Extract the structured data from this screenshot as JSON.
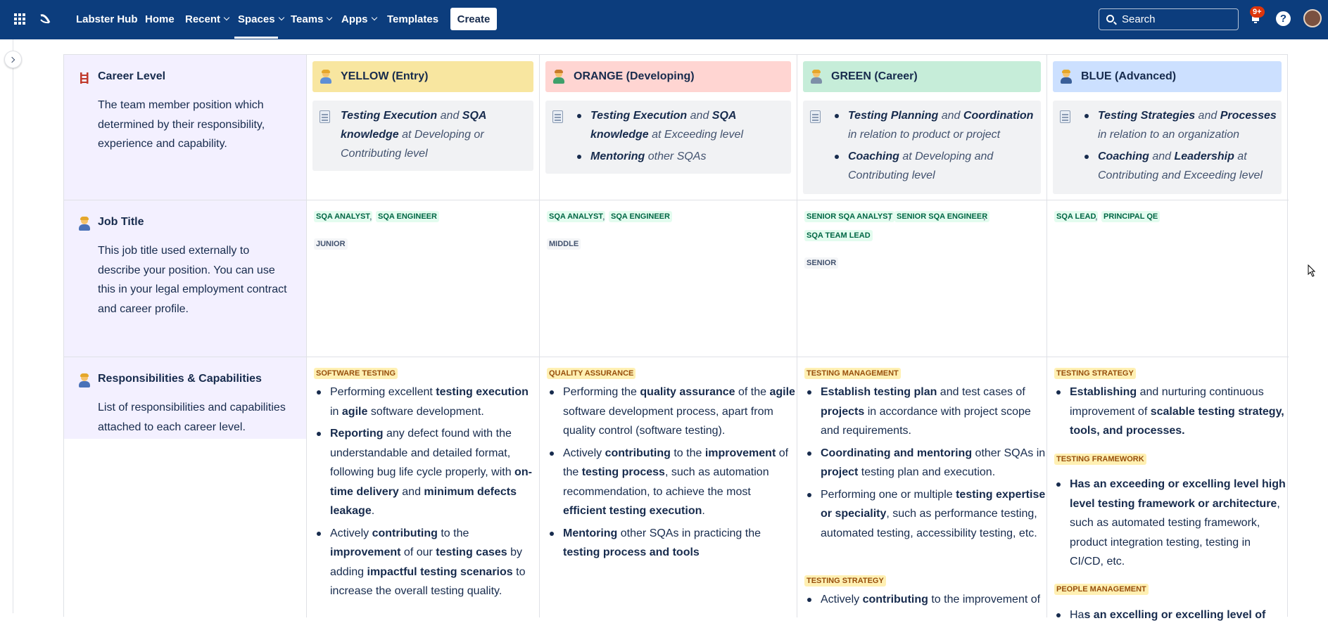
{
  "nav": {
    "brand": "Labster Hub",
    "home": "Home",
    "recent": "Recent",
    "spaces": "Spaces",
    "teams": "Teams",
    "apps": "Apps",
    "templates": "Templates",
    "create": "Create",
    "search_placeholder": "Search",
    "notif_badge": "9+",
    "help": "?"
  },
  "colors": {
    "topbar": "#0c3d7d",
    "yellow": "#f8e6a0",
    "orange": "#ffd5d2",
    "green": "#c6edd9",
    "blue": "#cce0ff",
    "rowhead": "#f3f0ff"
  },
  "levels": [
    {
      "label": "YELLOW (Entry)"
    },
    {
      "label": "ORANGE (Developing)"
    },
    {
      "label": "GREEN (Career)"
    },
    {
      "label": "BLUE (Advanced)"
    }
  ],
  "rows": {
    "career": {
      "title": "Career Level",
      "desc": "The team member position which determined by their responsibility, experience and capability.",
      "icon": "ladder-icon"
    },
    "job": {
      "title": "Job Title",
      "desc": "This job title used externally to describe your position. You can use this in your legal employment contract and career profile.",
      "icon": "person-icon"
    },
    "resp": {
      "title": "Responsibilities & Capabilities",
      "desc": "List of responsibilities and capabilities attached to each career level.",
      "icon": "person-icon"
    }
  },
  "career_cells": {
    "yellow": {
      "p1": "Testing Execution",
      "p2": " and ",
      "p3": "SQA knowledge",
      "p4": " at Developing or Contributing level"
    },
    "orange": {
      "b1": "Testing Execution",
      "b1b": " and ",
      "b1c": "SQA knowledge",
      "b1d": " at Exceeding level",
      "b2": "Mentoring",
      "b2b": " other SQAs"
    },
    "green": {
      "b1": "Testing Planning",
      "b1b": " and ",
      "b1c": "Coordination",
      "b1d": " in relation to product or project",
      "b2": "Coaching",
      "b2b": " at Developing and Contributing level"
    },
    "blue": {
      "b1": "Testing Strategies",
      "b1b": " and ",
      "b1c": "Processes",
      "b1d": " in relation to an organization",
      "b2": "Coaching",
      "b2b": " and ",
      "b2c": "Leadership",
      "b2d": " at Contributing and Exceeding level"
    }
  },
  "job_titles": {
    "yellow": {
      "t1": "SQA ANALYST",
      "t2": "SQA ENGINEER",
      "level": "JUNIOR"
    },
    "orange": {
      "t1": "SQA ANALYST",
      "t2": "SQA ENGINEER",
      "level": "MIDDLE"
    },
    "green": {
      "t1": "SENIOR SQA ANALYST",
      "t2": "SENIOR SQA ENGINEER",
      "t3": "SQA TEAM LEAD",
      "level": "SENIOR"
    },
    "blue": {
      "t1": "SQA LEAD",
      "t2": "PRINCIPAL QE"
    },
    "comma": ","
  },
  "resp_cells": {
    "yellow": {
      "tag": "SOFTWARE TESTING",
      "i1": [
        "Performing excellent ",
        "testing execution",
        " in ",
        "agile",
        " software development."
      ],
      "i2": [
        "Reporting",
        " any defect found with the understandable and detailed format, following bug life cycle properly, with ",
        "on-time delivery",
        " and ",
        "minimum defects leakage",
        "."
      ],
      "i3": [
        "Actively ",
        "contributing",
        " to the ",
        "improvement",
        " of our ",
        "testing cases",
        " by adding ",
        "impactful testing scenarios",
        " to increase the overall testing quality."
      ]
    },
    "orange": {
      "tag": "QUALITY ASSURANCE",
      "i1": [
        "Performing the ",
        "quality assurance",
        " of the ",
        "agile",
        " software development process, apart from quality control (software testing)."
      ],
      "i2": [
        "Actively ",
        "contributing",
        " to the ",
        "improvement",
        " of the ",
        "testing process",
        ", such as automation recommendation, to achieve the most ",
        "efficient testing execution",
        "."
      ],
      "i3": [
        "Mentoring",
        " other SQAs in practicing the ",
        "testing process and tools"
      ]
    },
    "green": {
      "tag": "TESTING MANAGEMENT",
      "tag2": "TESTING STRATEGY",
      "i1": [
        "Establish testing plan",
        " and test cases of ",
        "projects",
        " in accordance with project scope and requirements."
      ],
      "i2": [
        "Coordinating and mentoring",
        " other SQAs in ",
        "project",
        " testing plan and execution."
      ],
      "i3": [
        "Performing one or multiple ",
        "testing expertise or speciality",
        ", such as performance testing, automated testing, accessibility testing, etc."
      ],
      "i4": [
        "Actively ",
        "contributing",
        " to the improvement of"
      ]
    },
    "blue": {
      "tag": "TESTING STRATEGY",
      "tag2": "TESTING FRAMEWORK",
      "tag3": "PEOPLE MANAGEMENT",
      "i1": [
        "Establishing",
        " and nurturing continuous improvement of ",
        "scalable testing strategy, tools, and processes."
      ],
      "i2": [
        "Has an exceeding or excelling level high level testing framework or architecture",
        ", such as automated testing framework, product integration testing, testing in CI/CD, etc."
      ],
      "i3": [
        "Ha",
        "s an excelling or excelling level of"
      ]
    }
  }
}
